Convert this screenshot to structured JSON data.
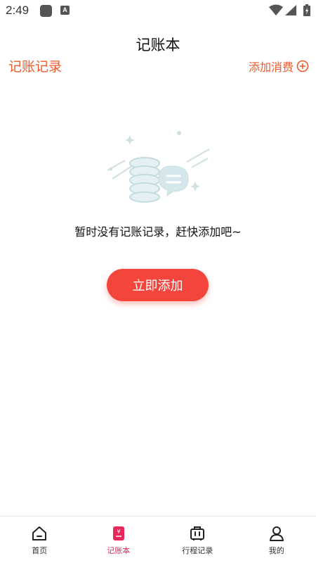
{
  "status_bar": {
    "time": "2:49",
    "icons": [
      "app-icon",
      "a-icon",
      "wifi-icon",
      "signal-icon",
      "battery-icon"
    ]
  },
  "header": {
    "title": "记账本",
    "records_link": "记账记录",
    "add_expense_label": "添加消费",
    "add_expense_icon": "plus-circle-icon"
  },
  "empty_state": {
    "illustration_icon": "coins-chat-icon",
    "message": "暂时没有记账记录，赶快添加吧~",
    "add_button_label": "立即添加"
  },
  "bottom_nav": {
    "items": [
      {
        "label": "首页",
        "icon": "home-icon",
        "active": false
      },
      {
        "label": "记账本",
        "icon": "ledger-icon",
        "active": true
      },
      {
        "label": "行程记录",
        "icon": "luggage-icon",
        "active": false
      },
      {
        "label": "我的",
        "icon": "profile-icon",
        "active": false
      }
    ]
  },
  "colors": {
    "accent": "#f05a2a",
    "button": "#f4453d",
    "active_tab": "#e8275a"
  }
}
